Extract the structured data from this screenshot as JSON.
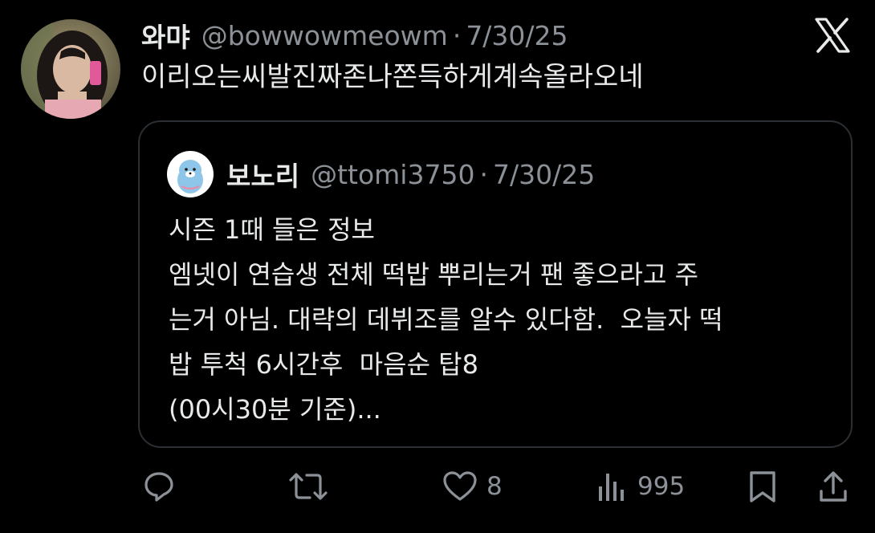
{
  "tweet": {
    "display_name": "와먀",
    "handle": "@bowwowmeowm",
    "separator": "·",
    "date": "7/30/25",
    "text": "이리오는씨발진짜존나쫀득하게계속올라오네",
    "avatar_icon": "profile-photo-avatar"
  },
  "quote": {
    "display_name": "보노리",
    "handle": "@ttomi3750",
    "separator": "·",
    "date": "7/30/25",
    "avatar_icon": "seal-mascot-avatar",
    "lines": [
      "시즌 1때 들은 정보",
      "엠넷이 연습생 전체 떡밥 뿌리는거 팬 좋으라고 주",
      "는거 아님. 대략의 데뷔조를 알수 있다함.  오늘자 떡",
      "밥 투척 6시간후  마음순 탑8",
      "(00시30분 기준)..."
    ]
  },
  "actions": {
    "reply": {
      "icon": "reply-icon",
      "count": ""
    },
    "retweet": {
      "icon": "retweet-icon",
      "count": ""
    },
    "like": {
      "icon": "heart-icon",
      "count": "8"
    },
    "views": {
      "icon": "views-icon",
      "count": "995"
    },
    "bookmark": {
      "icon": "bookmark-icon"
    },
    "share": {
      "icon": "share-icon"
    }
  },
  "branding": {
    "icon": "x-logo-icon"
  },
  "colors": {
    "background": "#000000",
    "text": "#e7e9ea",
    "secondary": "#8b9197",
    "border": "#2b2f33"
  }
}
